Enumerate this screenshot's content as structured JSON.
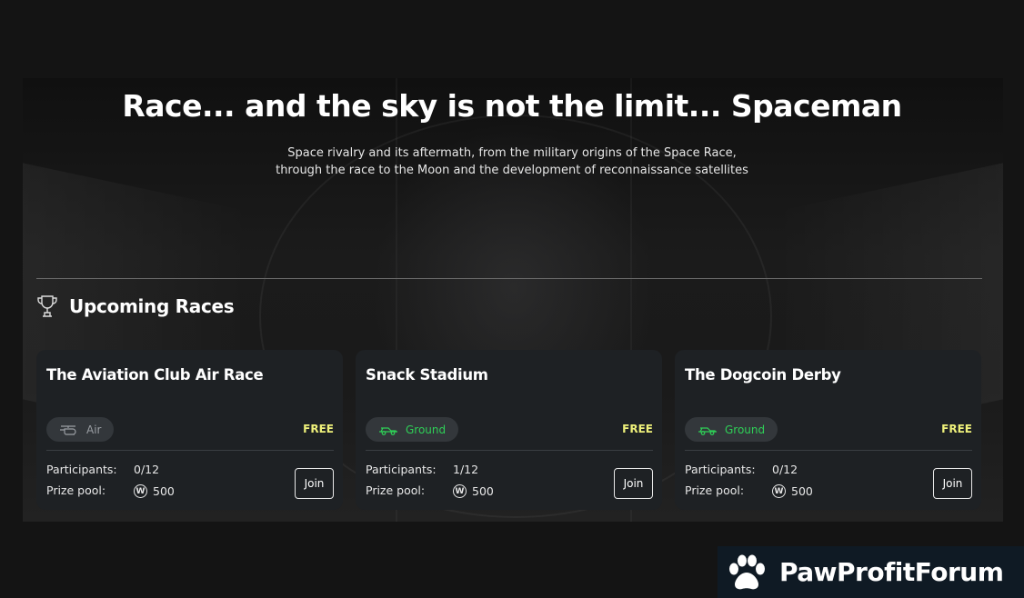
{
  "hero": {
    "title": "Race... and the sky is not the limit... Spaceman",
    "subtitle_line1": "Space rivalry and its aftermath, from the military origins of the Space Race,",
    "subtitle_line2": "through the race to the Moon and the development of reconnaissance satellites"
  },
  "section": {
    "title": "Upcoming Races",
    "icon": "trophy-icon"
  },
  "labels": {
    "participants": "Participants:",
    "prize_pool": "Prize pool:",
    "join": "Join",
    "coin_symbol": "W"
  },
  "races": [
    {
      "name": "The Aviation Club Air Race",
      "type": "Air",
      "type_icon": "helicopter-icon",
      "entry": "FREE",
      "participants": "0/12",
      "prize": "500"
    },
    {
      "name": "Snack Stadium",
      "type": "Ground",
      "type_icon": "car-icon",
      "entry": "FREE",
      "participants": "1/12",
      "prize": "500"
    },
    {
      "name": "The Dogcoin Derby",
      "type": "Ground",
      "type_icon": "car-icon",
      "entry": "FREE",
      "participants": "0/12",
      "prize": "500"
    }
  ],
  "colors": {
    "free": "#eef07a",
    "ground": "#2fcf57",
    "card_bg": "#1e2124"
  },
  "watermark": {
    "text": "PawProfitForum"
  }
}
